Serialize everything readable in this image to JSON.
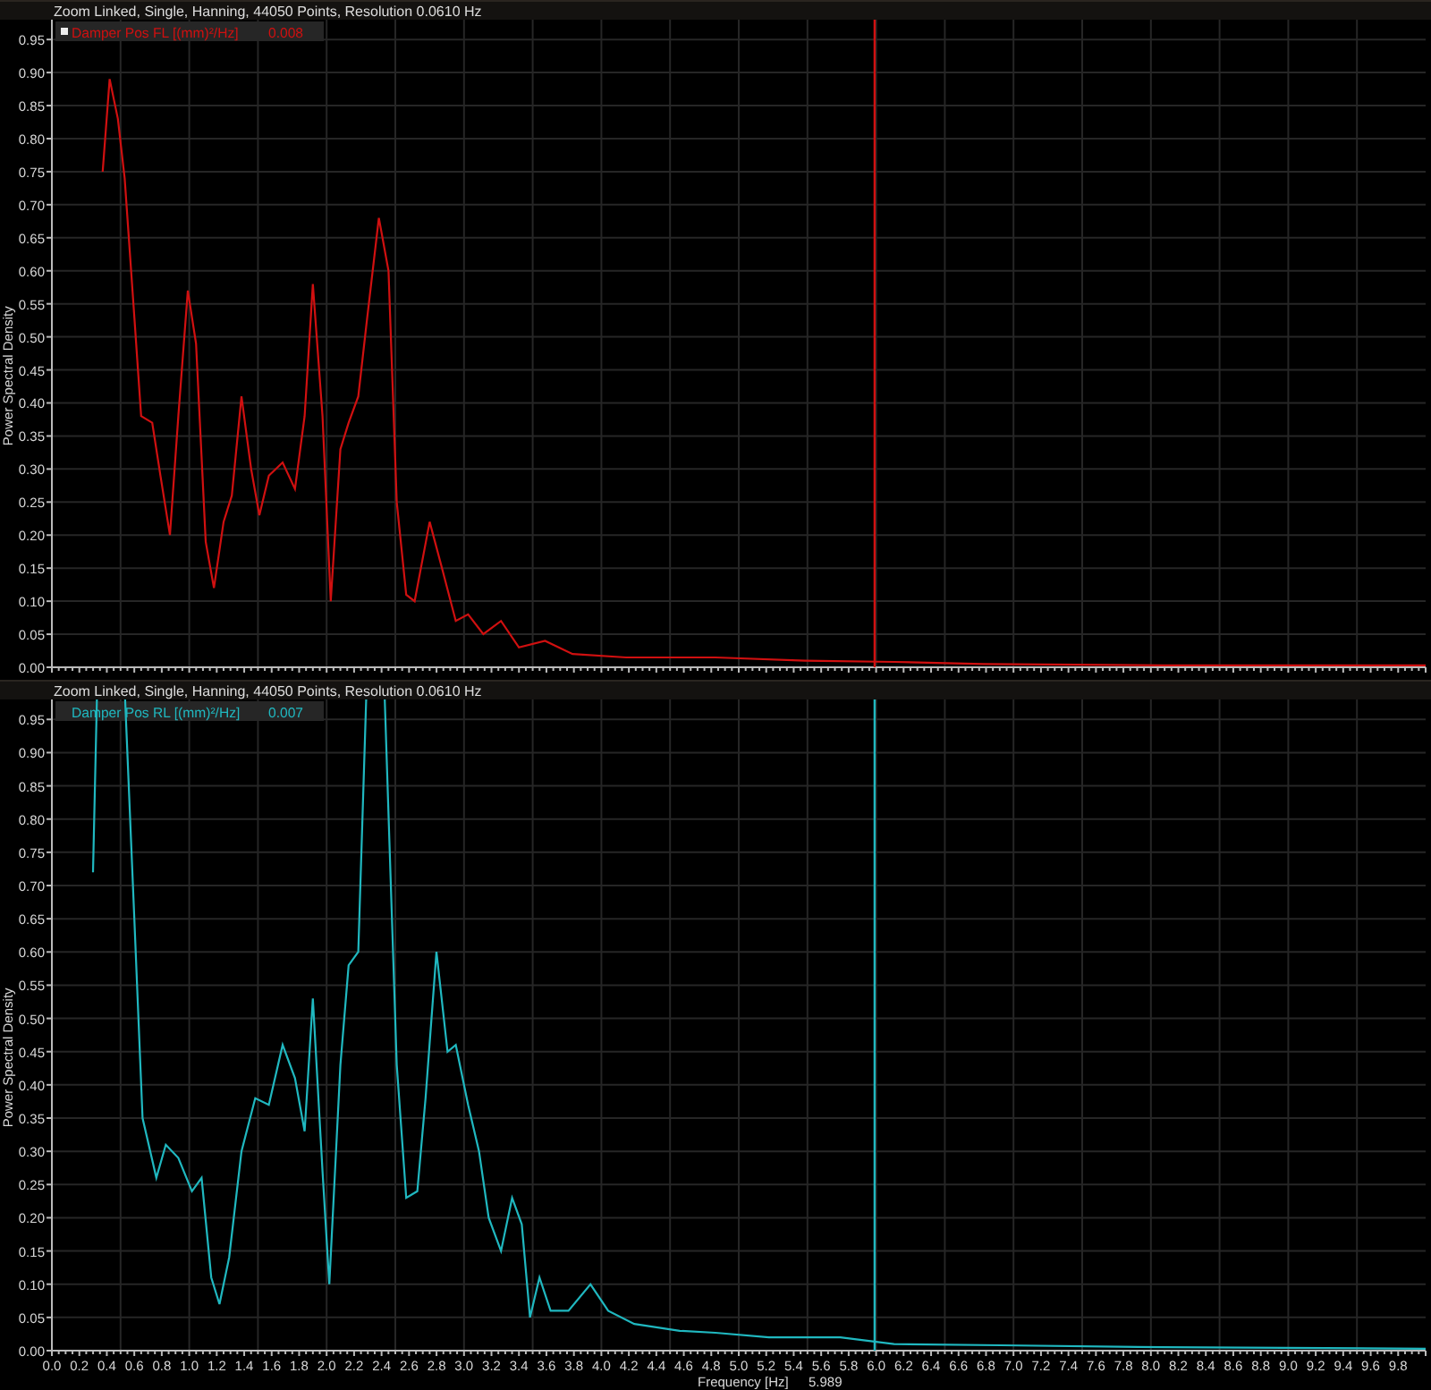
{
  "panels": [
    {
      "header": "Zoom Linked, Single, Hanning, 44050 Points, Resolution 0.0610 Hz",
      "legend": {
        "marker": true,
        "units": "[(mm)²/Hz]",
        "reading": "0.008"
      },
      "chart_data": {
        "type": "line",
        "ylabel": "Power Spectral Density",
        "grid": true,
        "xlim": [
          0,
          10
        ],
        "ylim": [
          0,
          0.98
        ],
        "yticks": [
          {
            "value": 0,
            "label": "0.00"
          },
          {
            "value": 0.05,
            "label": "0.05"
          },
          {
            "value": 0.1,
            "label": "0.10"
          },
          {
            "value": 0.15,
            "label": "0.15"
          },
          {
            "value": 0.2,
            "label": "0.20"
          },
          {
            "value": 0.25,
            "label": "0.25"
          },
          {
            "value": 0.3,
            "label": "0.30"
          },
          {
            "value": 0.35,
            "label": "0.35"
          },
          {
            "value": 0.4,
            "label": "0.40"
          },
          {
            "value": 0.45,
            "label": "0.45"
          },
          {
            "value": 0.5,
            "label": "0.50"
          },
          {
            "value": 0.55,
            "label": "0.55"
          },
          {
            "value": 0.6,
            "label": "0.60"
          },
          {
            "value": 0.65,
            "label": "0.65"
          },
          {
            "value": 0.7,
            "label": "0.70"
          },
          {
            "value": 0.75,
            "label": "0.75"
          },
          {
            "value": 0.8,
            "label": "0.80"
          },
          {
            "value": 0.85,
            "label": "0.85"
          },
          {
            "value": 0.9,
            "label": "0.90"
          },
          {
            "value": 0.95,
            "label": "0.95"
          }
        ],
        "x": [
          0.37,
          0.42,
          0.48,
          0.53,
          0.6,
          0.65,
          0.73,
          0.79,
          0.86,
          0.92,
          0.99,
          1.05,
          1.12,
          1.18,
          1.25,
          1.31,
          1.38,
          1.45,
          1.51,
          1.58,
          1.68,
          1.77,
          1.84,
          1.9,
          1.97,
          2.03,
          2.1,
          2.16,
          2.23,
          2.29,
          2.38,
          2.45,
          2.51,
          2.58,
          2.64,
          2.75,
          2.84,
          2.94,
          3.03,
          3.14,
          3.27,
          3.4,
          3.59,
          3.79,
          4.18,
          4.83,
          5.48,
          6.13,
          6.78,
          8.09,
          10
        ],
        "series": [
          {
            "name": "Damper Pos FL",
            "color": "#d01010",
            "values": [
              0.75,
              0.89,
              0.83,
              0.74,
              0.53,
              0.38,
              0.37,
              0.29,
              0.2,
              0.38,
              0.57,
              0.49,
              0.19,
              0.12,
              0.22,
              0.26,
              0.41,
              0.3,
              0.23,
              0.29,
              0.31,
              0.27,
              0.38,
              0.58,
              0.38,
              0.1,
              0.33,
              0.37,
              0.41,
              0.52,
              0.68,
              0.6,
              0.25,
              0.11,
              0.1,
              0.22,
              0.15,
              0.07,
              0.08,
              0.05,
              0.07,
              0.03,
              0.04,
              0.02,
              0.015,
              0.015,
              0.01,
              0.008,
              0.005,
              0.003,
              0.003
            ]
          }
        ],
        "ref_lines": [
          {
            "axis": "x",
            "value": 5.989
          }
        ]
      }
    },
    {
      "header": "Zoom Linked, Single, Hanning, 44050 Points, Resolution 0.0610 Hz",
      "legend": {
        "marker": false,
        "units": "[(mm)²/Hz]",
        "reading": "0.007"
      },
      "cursor_reading": "5.989",
      "chart_data": {
        "type": "line",
        "xlabel": "Frequency [Hz]",
        "ylabel": "Power Spectral Density",
        "grid": true,
        "xlim": [
          0,
          10
        ],
        "ylim": [
          0,
          0.98
        ],
        "xticks": [
          {
            "value": 0,
            "label": "0.0"
          },
          {
            "value": 0.2,
            "label": "0.2"
          },
          {
            "value": 0.4,
            "label": "0.4"
          },
          {
            "value": 0.6,
            "label": "0.6"
          },
          {
            "value": 0.8,
            "label": "0.8"
          },
          {
            "value": 1,
            "label": "1.0"
          },
          {
            "value": 1.2,
            "label": "1.2"
          },
          {
            "value": 1.4,
            "label": "1.4"
          },
          {
            "value": 1.6,
            "label": "1.6"
          },
          {
            "value": 1.8,
            "label": "1.8"
          },
          {
            "value": 2,
            "label": "2.0"
          },
          {
            "value": 2.2,
            "label": "2.2"
          },
          {
            "value": 2.4,
            "label": "2.4"
          },
          {
            "value": 2.6,
            "label": "2.6"
          },
          {
            "value": 2.8,
            "label": "2.8"
          },
          {
            "value": 3,
            "label": "3.0"
          },
          {
            "value": 3.2,
            "label": "3.2"
          },
          {
            "value": 3.4,
            "label": "3.4"
          },
          {
            "value": 3.6,
            "label": "3.6"
          },
          {
            "value": 3.8,
            "label": "3.8"
          },
          {
            "value": 4,
            "label": "4.0"
          },
          {
            "value": 4.2,
            "label": "4.2"
          },
          {
            "value": 4.4,
            "label": "4.4"
          },
          {
            "value": 4.6,
            "label": "4.6"
          },
          {
            "value": 4.8,
            "label": "4.8"
          },
          {
            "value": 5,
            "label": "5.0"
          },
          {
            "value": 5.2,
            "label": "5.2"
          },
          {
            "value": 5.4,
            "label": "5.4"
          },
          {
            "value": 5.6,
            "label": "5.6"
          },
          {
            "value": 5.8,
            "label": "5.8"
          },
          {
            "value": 6,
            "label": "6.0"
          },
          {
            "value": 6.2,
            "label": "6.2"
          },
          {
            "value": 6.4,
            "label": "6.4"
          },
          {
            "value": 6.6,
            "label": "6.6"
          },
          {
            "value": 6.8,
            "label": "6.8"
          },
          {
            "value": 7,
            "label": "7.0"
          },
          {
            "value": 7.2,
            "label": "7.2"
          },
          {
            "value": 7.4,
            "label": "7.4"
          },
          {
            "value": 7.6,
            "label": "7.6"
          },
          {
            "value": 7.8,
            "label": "7.8"
          },
          {
            "value": 8,
            "label": "8.0"
          },
          {
            "value": 8.2,
            "label": "8.2"
          },
          {
            "value": 8.4,
            "label": "8.4"
          },
          {
            "value": 8.6,
            "label": "8.6"
          },
          {
            "value": 8.8,
            "label": "8.8"
          },
          {
            "value": 9,
            "label": "9.0"
          },
          {
            "value": 9.2,
            "label": "9.2"
          },
          {
            "value": 9.4,
            "label": "9.4"
          },
          {
            "value": 9.6,
            "label": "9.6"
          },
          {
            "value": 9.8,
            "label": "9.8"
          }
        ],
        "yticks": [
          {
            "value": 0,
            "label": "0.00"
          },
          {
            "value": 0.05,
            "label": "0.05"
          },
          {
            "value": 0.1,
            "label": "0.10"
          },
          {
            "value": 0.15,
            "label": "0.15"
          },
          {
            "value": 0.2,
            "label": "0.20"
          },
          {
            "value": 0.25,
            "label": "0.25"
          },
          {
            "value": 0.3,
            "label": "0.30"
          },
          {
            "value": 0.35,
            "label": "0.35"
          },
          {
            "value": 0.4,
            "label": "0.40"
          },
          {
            "value": 0.45,
            "label": "0.45"
          },
          {
            "value": 0.5,
            "label": "0.50"
          },
          {
            "value": 0.55,
            "label": "0.55"
          },
          {
            "value": 0.6,
            "label": "0.60"
          },
          {
            "value": 0.65,
            "label": "0.65"
          },
          {
            "value": 0.7,
            "label": "0.70"
          },
          {
            "value": 0.75,
            "label": "0.75"
          },
          {
            "value": 0.8,
            "label": "0.80"
          },
          {
            "value": 0.85,
            "label": "0.85"
          },
          {
            "value": 0.9,
            "label": "0.90"
          },
          {
            "value": 0.95,
            "label": "0.95"
          }
        ],
        "x": [
          0.3,
          0.33,
          0.53,
          0.6,
          0.66,
          0.76,
          0.83,
          0.92,
          1.02,
          1.09,
          1.16,
          1.22,
          1.29,
          1.38,
          1.48,
          1.58,
          1.68,
          1.77,
          1.84,
          1.9,
          1.97,
          2.02,
          2.1,
          2.16,
          2.23,
          2.29,
          2.42,
          2.51,
          2.58,
          2.66,
          2.72,
          2.8,
          2.88,
          2.94,
          3.03,
          3.11,
          3.18,
          3.27,
          3.35,
          3.42,
          3.48,
          3.55,
          3.63,
          3.76,
          3.92,
          4.05,
          4.24,
          4.57,
          4.83,
          5.22,
          5.74,
          6.13,
          6.91,
          8.09,
          10
        ],
        "series": [
          {
            "name": "Damper Pos RL",
            "color": "#20b8c0",
            "values": [
              0.72,
              null,
              null,
              0.65,
              0.35,
              0.26,
              0.31,
              0.29,
              0.24,
              0.26,
              0.11,
              0.07,
              0.14,
              0.3,
              0.38,
              0.37,
              0.46,
              0.41,
              0.33,
              0.53,
              0.27,
              0.1,
              0.43,
              0.58,
              0.6,
              null,
              null,
              0.43,
              0.23,
              0.24,
              0.38,
              0.6,
              0.45,
              0.46,
              0.37,
              0.3,
              0.2,
              0.15,
              0.23,
              0.19,
              0.05,
              0.11,
              0.06,
              0.06,
              0.1,
              0.06,
              0.04,
              0.03,
              0.027,
              0.02,
              0.02,
              0.01,
              0.008,
              0.005,
              0.003
            ]
          }
        ],
        "ref_lines": [
          {
            "axis": "x",
            "value": 5.989
          }
        ]
      }
    }
  ]
}
